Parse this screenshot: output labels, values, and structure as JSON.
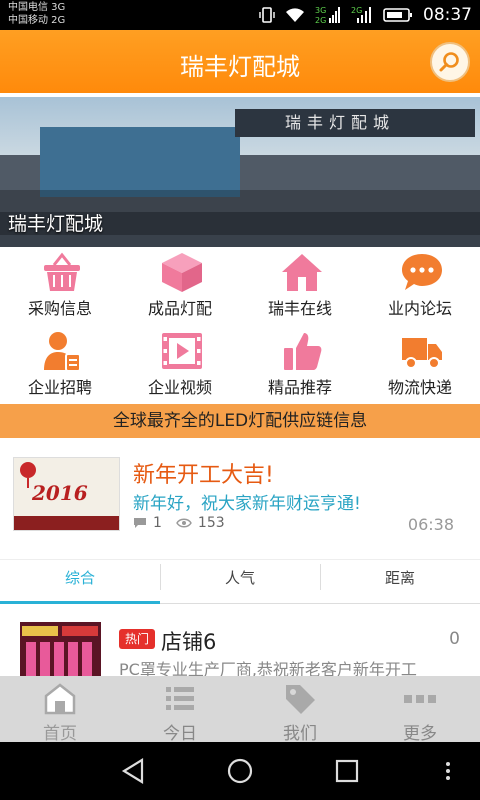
{
  "status_bar": {
    "carrier_1": "中国电信 3G",
    "carrier_2": "中国移动 2G",
    "time": "08:37",
    "icons": [
      "vibrate-icon",
      "wifi-icon",
      "signal-3g-icon",
      "signal-2g-icon",
      "battery-icon"
    ]
  },
  "header": {
    "title": "瑞丰灯配城",
    "search_icon": "search-icon",
    "accent": "#ff8f10"
  },
  "banner": {
    "caption": "瑞丰灯配城",
    "sign_text": "瑞丰灯配城"
  },
  "categories": [
    {
      "label": "采购信息",
      "icon": "basket-icon"
    },
    {
      "label": "成品灯配",
      "icon": "box-icon"
    },
    {
      "label": "瑞丰在线",
      "icon": "home-icon"
    },
    {
      "label": "业内论坛",
      "icon": "chat-bubble-icon"
    },
    {
      "label": "企业招聘",
      "icon": "person-card-icon"
    },
    {
      "label": "企业视频",
      "icon": "film-icon"
    },
    {
      "label": "精品推荐",
      "icon": "thumbs-up-icon"
    },
    {
      "label": "物流快递",
      "icon": "truck-icon"
    }
  ],
  "notice": "全球最齐全的LED灯配供应链信息",
  "news": {
    "title": "新年开工大吉!",
    "subtitle": "新年好，祝大家新年财运亨通!",
    "comments": "1",
    "views": "153",
    "time": "06:38",
    "image_text": "2016"
  },
  "tabs": [
    {
      "label": "综合",
      "active": true
    },
    {
      "label": "人气",
      "active": false
    },
    {
      "label": "距离",
      "active": false
    }
  ],
  "shop": {
    "badge": "热门",
    "name": "店铺6",
    "count": "0",
    "desc": "PC罩专业生产厂商,恭祝新老客户新年开工"
  },
  "bottom_nav": [
    {
      "label": "首页",
      "icon": "home-outline-icon"
    },
    {
      "label": "今日",
      "icon": "list-icon"
    },
    {
      "label": "我们",
      "icon": "tag-icon"
    },
    {
      "label": "更多",
      "icon": "more-dots-icon"
    }
  ],
  "colors": {
    "primary_orange": "#ff8f10",
    "notice_bg": "#f6a04a",
    "tab_active": "#29b1d6",
    "news_title": "#e65a12",
    "news_sub": "#2aa4c4",
    "hot_badge": "#e5302b",
    "icon_pink": "#f07a9c",
    "icon_orange": "#f27d2f"
  }
}
